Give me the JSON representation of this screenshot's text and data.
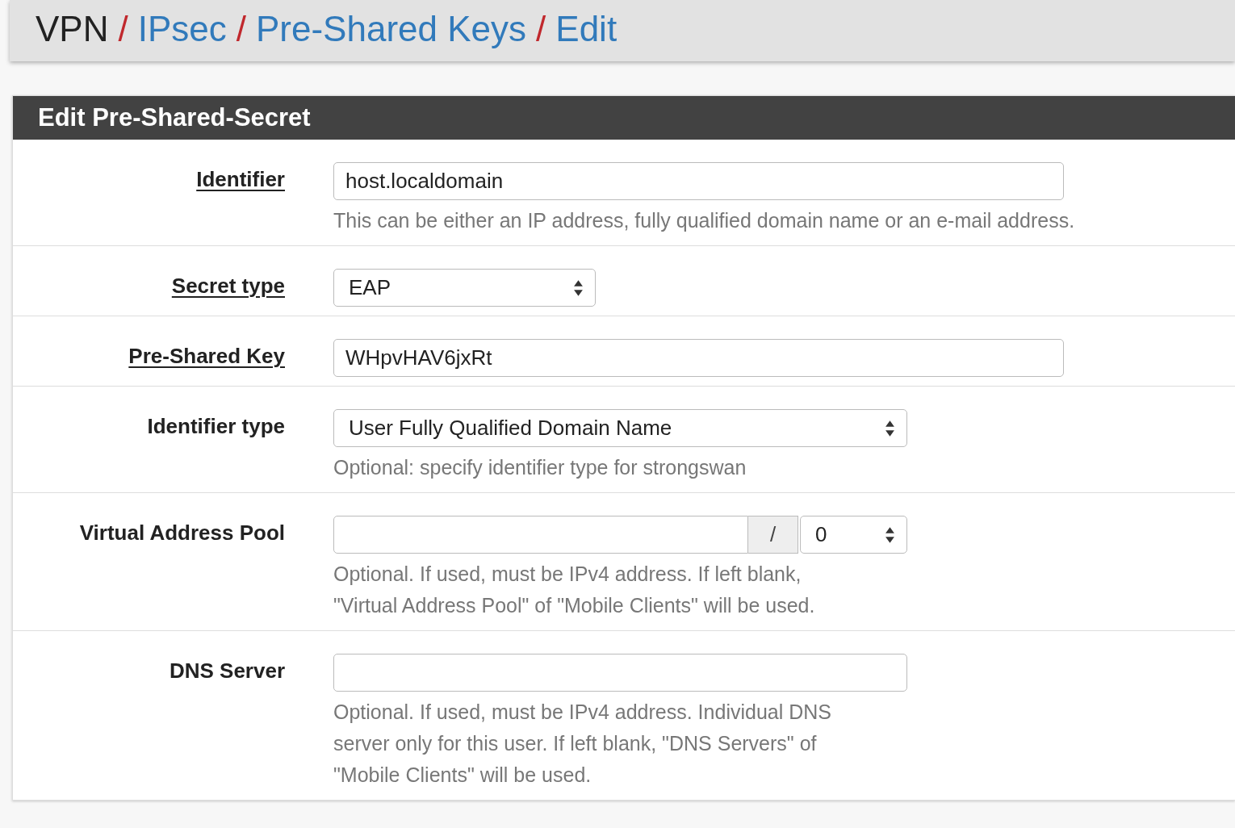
{
  "breadcrumb": [
    {
      "text": "VPN",
      "link": false,
      "separator": "/"
    },
    {
      "text": "IPsec",
      "link": true,
      "separator": "/"
    },
    {
      "text": "Pre-Shared Keys",
      "link": true,
      "separator": "/"
    },
    {
      "text": "Edit",
      "link": true
    }
  ],
  "panel": {
    "title": "Edit Pre-Shared-Secret",
    "fields": [
      {
        "kind": "input",
        "label": "Identifier",
        "required": true,
        "value": "host.localdomain",
        "help": [
          "This can be either an IP address, fully qualified domain name or an e-mail address."
        ]
      },
      {
        "kind": "select",
        "label": "Secret type",
        "required": true,
        "value": "EAP"
      },
      {
        "kind": "input",
        "label": "Pre-Shared Key",
        "required": true,
        "value": "WHpvHAV6jxRt"
      },
      {
        "kind": "wide-select",
        "label": "Identifier type",
        "required": false,
        "value": "User Fully Qualified Domain Name",
        "help": [
          "Optional: specify identifier type for strongswan"
        ]
      },
      {
        "kind": "addon",
        "label": "Virtual Address Pool",
        "required": false,
        "addon": "/",
        "mask": "0",
        "help": [
          "Optional. If used, must be IPv4 address. If left blank,",
          "\"Virtual Address Pool\" of \"Mobile Clients\" will be used."
        ]
      },
      {
        "kind": "short-input",
        "label": "DNS Server",
        "required": false,
        "help": [
          "Optional. If used, must be IPv4 address. Individual DNS",
          "server only for this user. If left blank, \"DNS Servers\" of",
          "\"Mobile Clients\" will be used."
        ]
      }
    ]
  }
}
